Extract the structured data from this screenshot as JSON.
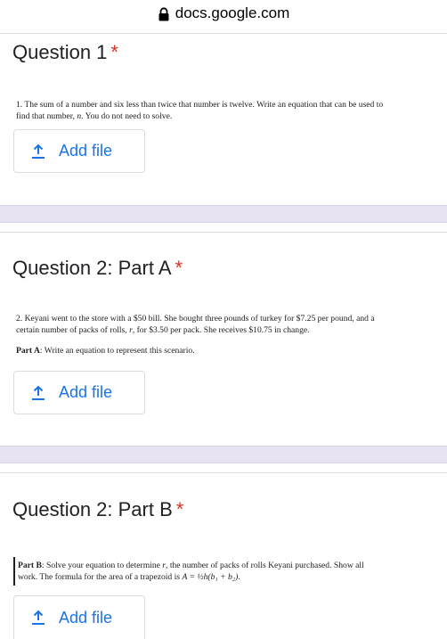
{
  "browser": {
    "url": "docs.google.com",
    "lock_icon": "lock-icon"
  },
  "questions": [
    {
      "title": "Question 1",
      "required_mark": "*",
      "text_line1": "1. The sum of a number and six less than twice that number is twelve.  Write an equation that can be used to",
      "text_line2_pre": "find that number, ",
      "text_var": "n",
      "text_line2_post": ".  You do not need to solve.",
      "add_file_label": "Add file"
    },
    {
      "title": "Question 2: Part A",
      "required_mark": "*",
      "text_line1": "2. Keyani went to the store with a $50 bill.  She bought three pounds of turkey for $7.25 per pound, and a",
      "text_line2_pre": "certain number of packs of rolls, ",
      "text_var": "r",
      "text_line2_post": ", for $3.50 per pack.  She receives $10.75 in change.",
      "part_label": "Part A",
      "part_text": ":  Write an equation to represent this scenario.",
      "add_file_label": "Add file"
    },
    {
      "title": "Question 2: Part B",
      "required_mark": "*",
      "part_label": "Part B",
      "text_line1_post": ":  Solve your equation to determine ",
      "text_var": "r",
      "text_line1_end": ", the number of packs of rolls Keyani purchased.  Show all",
      "text_line2_pre": "work. The formula for the area of a trapezoid is ",
      "formula": "A = ½h(b₁ + b₂)",
      "text_line2_post": ".",
      "add_file_label": "Add file"
    }
  ],
  "colors": {
    "accent": "#1a73e8",
    "required": "#d93025",
    "divider": "#e8e3f3"
  }
}
